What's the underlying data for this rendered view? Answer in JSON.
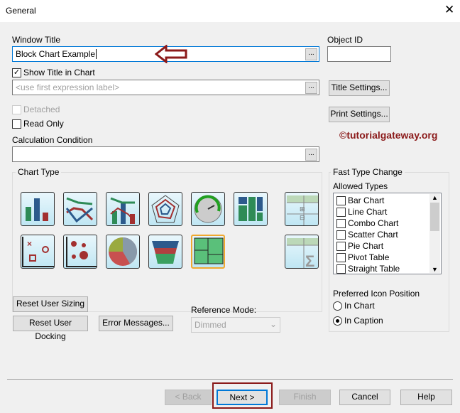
{
  "dialog": {
    "title": "General",
    "close_icon": "close-icon"
  },
  "window_title": {
    "label": "Window Title",
    "value": "Block Chart Example",
    "browse": "..."
  },
  "object_id": {
    "label": "Object ID",
    "value": ""
  },
  "show_title": {
    "label": "Show Title in Chart",
    "checked": true
  },
  "title_expr": {
    "placeholder": "<use first expression label>",
    "browse": "..."
  },
  "title_settings": "Title Settings...",
  "print_settings": "Print Settings...",
  "detached": {
    "label": "Detached",
    "checked": false
  },
  "read_only": {
    "label": "Read Only",
    "checked": false
  },
  "watermark": "©tutorialgateway.org",
  "calc_condition": {
    "label": "Calculation Condition",
    "value": "",
    "browse": "..."
  },
  "chart_type": {
    "label": "Chart Type",
    "types": [
      "bar-chart",
      "line-chart",
      "combo-chart",
      "radar-chart",
      "gauge-chart",
      "mekko-chart",
      "pivot-table",
      "scatter-chart",
      "grid-chart",
      "pie-chart",
      "funnel-chart",
      "block-chart",
      "straight-table"
    ],
    "selected": "block-chart"
  },
  "fast_type": {
    "label": "Fast Type Change",
    "allowed_label": "Allowed Types",
    "items": [
      "Bar Chart",
      "Line Chart",
      "Combo Chart",
      "Scatter Chart",
      "Pie Chart",
      "Pivot Table",
      "Straight Table"
    ],
    "pref_label": "Preferred Icon Position",
    "radio_in_chart": "In Chart",
    "radio_in_caption": "In Caption",
    "selected": "In Caption"
  },
  "reset_sizing": "Reset User Sizing",
  "reset_docking": "Reset User Docking",
  "error_messages": "Error Messages...",
  "reference_mode": {
    "label": "Reference Mode:",
    "value": "Dimmed"
  },
  "footer": {
    "back": "< Back",
    "next": "Next >",
    "finish": "Finish",
    "cancel": "Cancel",
    "help": "Help"
  },
  "colors": {
    "highlight": "#8b1a1a",
    "accent": "#0078d7"
  }
}
